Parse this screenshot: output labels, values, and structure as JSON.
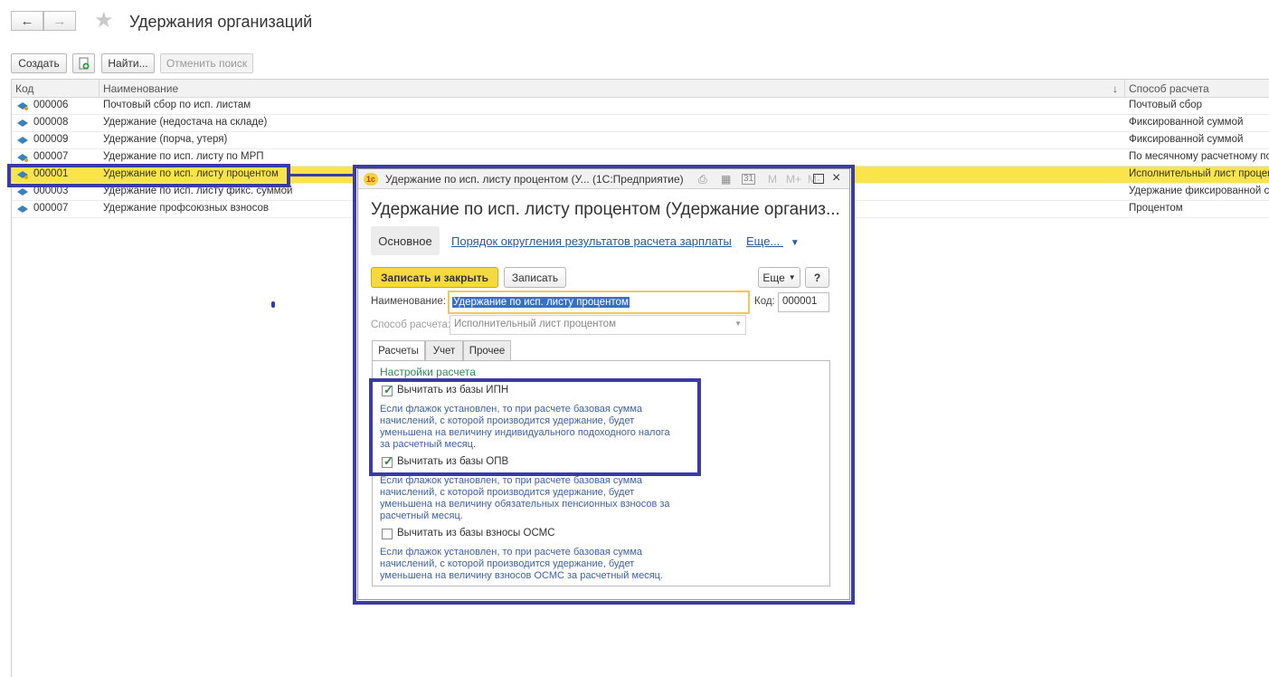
{
  "page": {
    "title": "Удержания организаций"
  },
  "toolbar": {
    "create": "Создать",
    "find": "Найти...",
    "cancel_search": "Отменить поиск"
  },
  "list": {
    "columns": [
      "Код",
      "Наименование",
      "Способ расчета"
    ],
    "sort_indicator": "↓",
    "rows": [
      {
        "code": "000006",
        "name": "Почтовый сбор по исп. листам",
        "method": "Почтовый сбор"
      },
      {
        "code": "000008",
        "name": "Удержание (недостача на складе)",
        "method": "Фиксированной суммой"
      },
      {
        "code": "000009",
        "name": "Удержание (порча, утеря)",
        "method": "Фиксированной суммой"
      },
      {
        "code": "000007",
        "name": "Удержание по исп. листу по МРП",
        "method": "По месячному расчетному пок"
      },
      {
        "code": "000001",
        "name": "Удержание по исп. листу процентом",
        "method": "Исполнительный лист процент"
      },
      {
        "code": "000003",
        "name": "Удержание по исп. листу фикс. суммой",
        "method": "Удержание фиксированной сум"
      },
      {
        "code": "000007",
        "name": "Удержание профсоюзных взносов",
        "method": "Процентом"
      }
    ]
  },
  "dialog": {
    "window_title": "Удержание по исп. листу процентом (У...  (1С:Предприятие)",
    "app_badge": "1с",
    "header": "Удержание по исп. листу процентом (Удержание организ...",
    "tabs_top": {
      "main": "Основное",
      "rounding_link": "Порядок округления результатов расчета зарплаты",
      "more": "Еще..."
    },
    "buttons": {
      "save_close": "Записать и закрыть",
      "save": "Записать",
      "more": "Еще",
      "help": "?"
    },
    "fields": {
      "name_label": "Наименование:",
      "name_value": "Удержание по исп. листу процентом",
      "code_label": "Код:",
      "code_value": "000001",
      "method_label": "Способ расчета:",
      "method_value": "Исполнительный лист процентом"
    },
    "tabs": [
      "Расчеты",
      "Учет",
      "Прочее"
    ],
    "section_title": "Настройки расчета",
    "checks": [
      {
        "label": "Вычитать из базы ИПН",
        "checked": true,
        "note": "Если флажок установлен, то при расчете базовая сумма начислений, с которой производится удержание, будет уменьшена на величину индивидуального подоходного налога за расчетный месяц."
      },
      {
        "label": "Вычитать из базы ОПВ",
        "checked": true,
        "note": "Если флажок установлен, то при расчете базовая сумма начислений, с которой производится удержание, будет уменьшена на величину обязательных пенсионных взносов за расчетный месяц."
      },
      {
        "label": "Вычитать из базы взносы ОСМС",
        "checked": false,
        "note": "Если флажок установлен, то при расчете базовая сумма начислений, с которой производится удержание, будет уменьшена на величину взносов ОСМС за расчетный месяц."
      }
    ]
  },
  "colors": {
    "selection": "#fbe34a",
    "highlight_frame": "#3a3aa8",
    "primary_button": "#f6d93e",
    "link": "#2a5a9c",
    "note_text": "#3d62a6"
  }
}
